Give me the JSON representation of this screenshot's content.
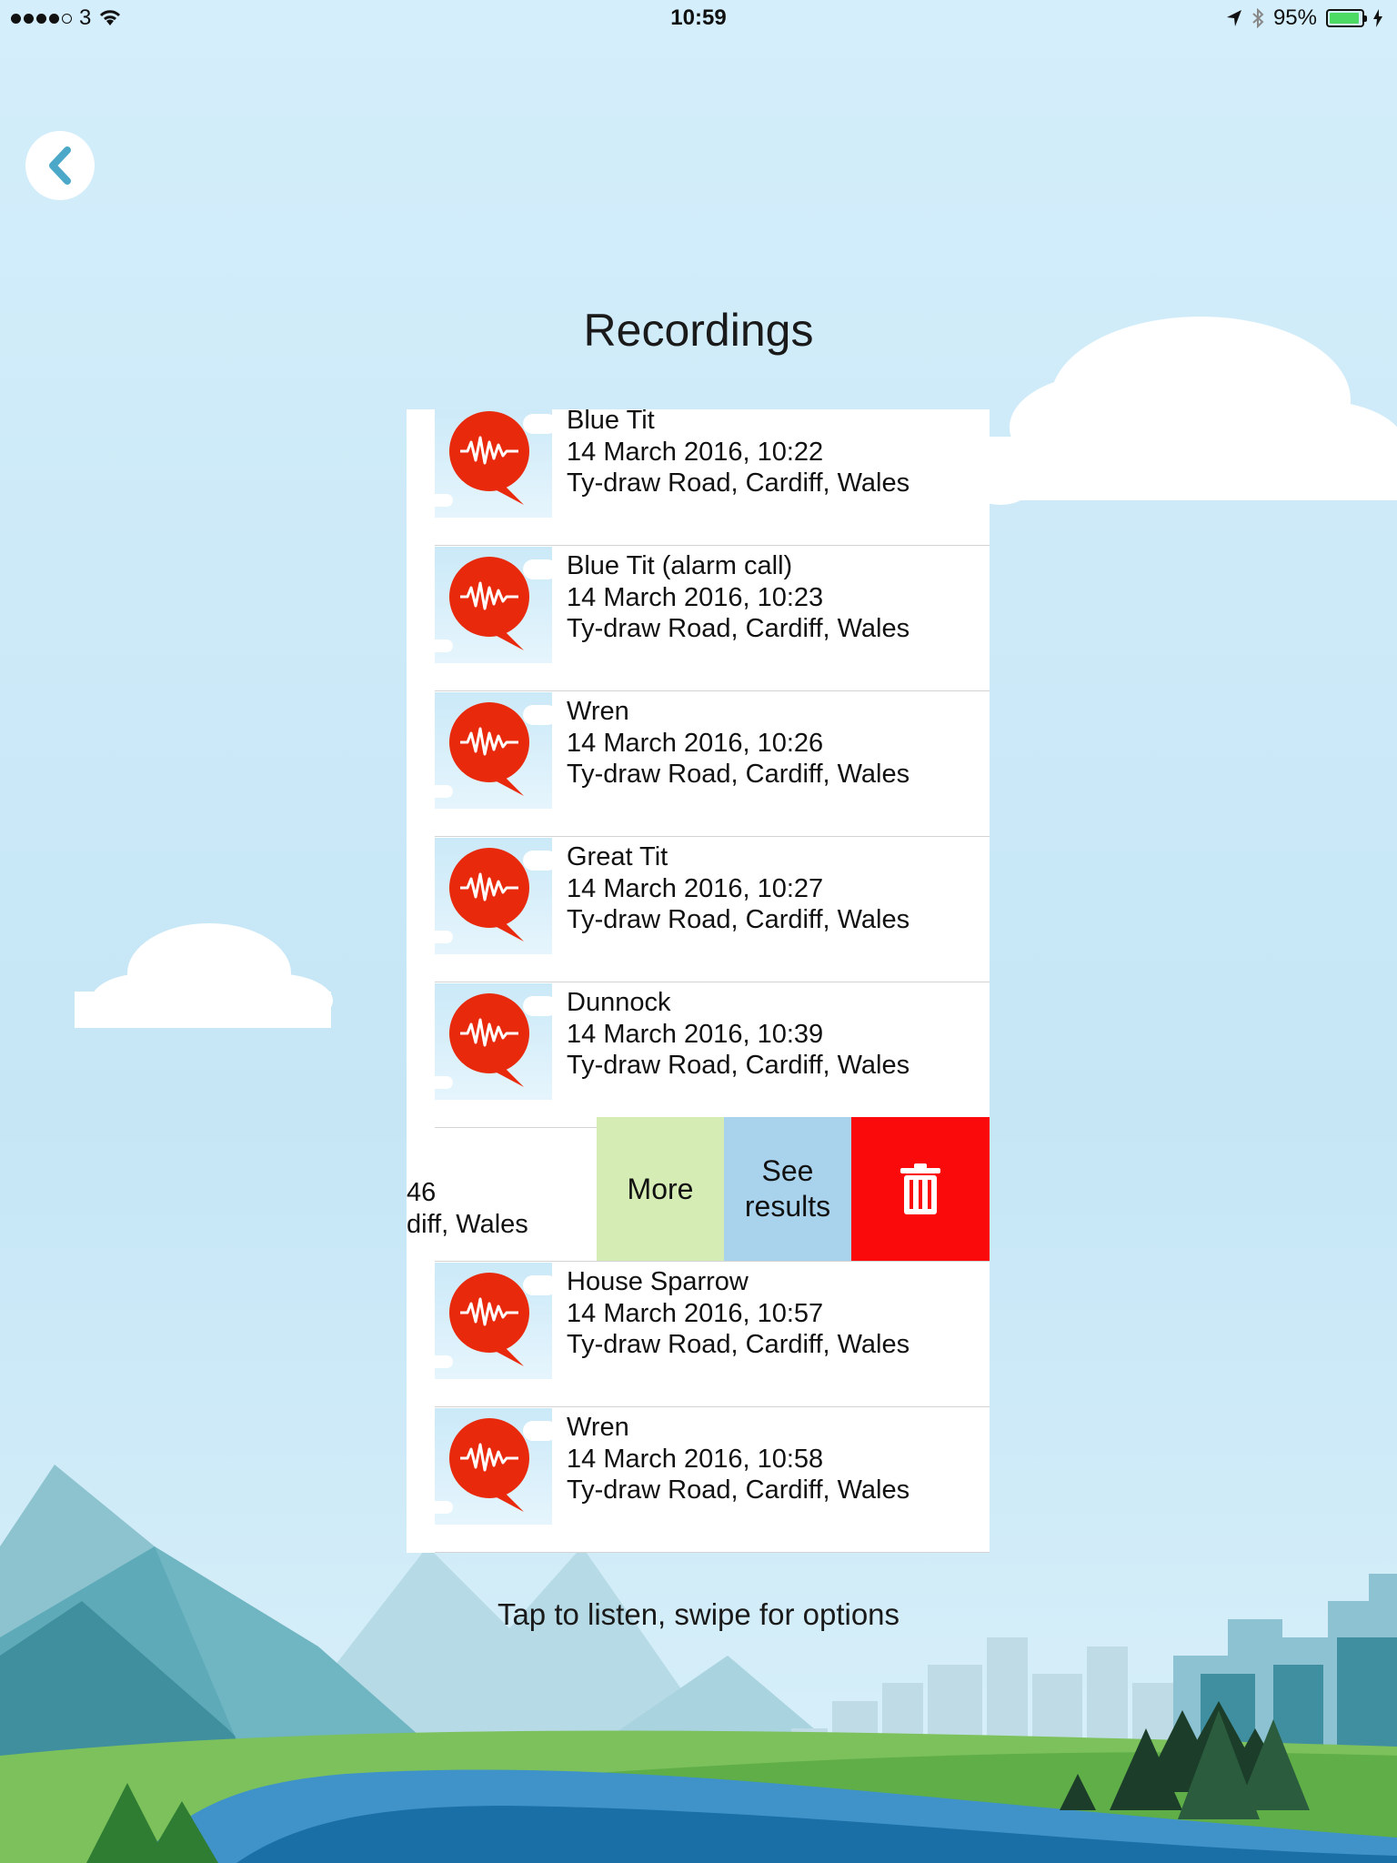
{
  "status_bar": {
    "carrier": "3",
    "time": "10:59",
    "battery_percent": "95%",
    "battery_level": 0.95
  },
  "page_title": "Recordings",
  "recordings": [
    {
      "name": "Blue Tit",
      "datetime": "14 March 2016, 10:22",
      "location": "Ty-draw Road, Cardiff, Wales"
    },
    {
      "name": "Blue Tit (alarm call)",
      "datetime": "14 March 2016, 10:23",
      "location": "Ty-draw Road, Cardiff, Wales"
    },
    {
      "name": "Wren",
      "datetime": "14 March 2016, 10:26",
      "location": "Ty-draw Road, Cardiff, Wales"
    },
    {
      "name": "Great Tit",
      "datetime": "14 March 2016, 10:27",
      "location": "Ty-draw Road, Cardiff, Wales"
    },
    {
      "name": "Dunnock",
      "datetime": "14 March 2016, 10:39",
      "location": "Ty-draw Road, Cardiff, Wales"
    },
    {
      "name": "House Sparrow",
      "datetime": "14 March 2016, 10:57",
      "location": "Ty-draw Road, Cardiff, Wales"
    },
    {
      "name": "Wren",
      "datetime": "14 March 2016, 10:58",
      "location": "Ty-draw Road, Cardiff, Wales"
    }
  ],
  "swiped_row": {
    "datetime_fragment": "46",
    "location_fragment": "diff, Wales"
  },
  "actions": {
    "more": "More",
    "see_results_line1": "See",
    "see_results_line2": "results",
    "delete_icon": "trash-icon"
  },
  "hint": "Tap to listen, swipe for options",
  "colors": {
    "sky": "#cdeaf8",
    "record_icon": "#e8290c",
    "more": "#d5ecb4",
    "see_results": "#a9d2ec",
    "delete": "#fa0a0a",
    "back_chevron": "#4ba8c8"
  }
}
